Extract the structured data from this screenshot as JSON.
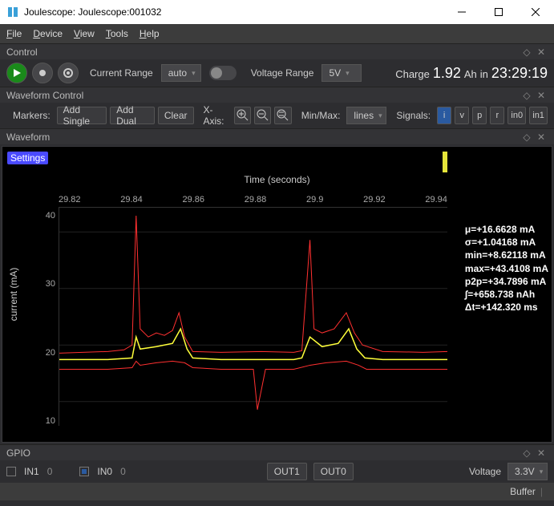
{
  "window": {
    "title": "Joulescope: Joulescope:001032"
  },
  "menu": {
    "file": "File",
    "device": "Device",
    "view": "View",
    "tools": "Tools",
    "help": "Help"
  },
  "panels": {
    "control": "Control",
    "wfctrl": "Waveform Control",
    "wf": "Waveform",
    "gpio": "GPIO"
  },
  "control": {
    "current_range_label": "Current Range",
    "current_range_value": "auto",
    "voltage_range_label": "Voltage Range",
    "voltage_range_value": "5V",
    "charge_label": "Charge",
    "charge_value": "1.92",
    "charge_unit": "Ah",
    "charge_in": "in",
    "charge_time": "23:29:19"
  },
  "wfctrl": {
    "markers_label": "Markers:",
    "add_single": "Add Single",
    "add_dual": "Add Dual",
    "clear": "Clear",
    "xaxis_label": "X-Axis:",
    "minmax_label": "Min/Max:",
    "minmax_value": "lines",
    "signals_label": "Signals:",
    "sig": {
      "i": "i",
      "v": "v",
      "p": "p",
      "r": "r",
      "in0": "in0",
      "in1": "in1"
    }
  },
  "chart_data": {
    "type": "line",
    "title": "Time (seconds)",
    "ylabel": "current (mA)",
    "xticks": [
      "29.82",
      "29.84",
      "29.86",
      "29.88",
      "29.9",
      "29.92",
      "29.94"
    ],
    "yticks": [
      "40",
      "30",
      "20",
      "10"
    ],
    "xlim": [
      29.81,
      29.955
    ],
    "ylim": [
      8,
      45
    ],
    "series": [
      {
        "name": "mean",
        "color": "#ffff3a"
      },
      {
        "name": "min",
        "color": "#ff3030"
      },
      {
        "name": "max",
        "color": "#ff3030"
      }
    ],
    "settings_btn": "Settings",
    "stats": {
      "mu": "μ=+16.6628 mA",
      "sigma": "σ=+1.04168 mA",
      "min": "min=+8.62118 mA",
      "max": "max=+43.4108 mA",
      "p2p": "p2p=+34.7896 mA",
      "int": "∫=+658.738 nAh",
      "dt": "Δt=+142.320 ms"
    }
  },
  "gpio": {
    "in1_label": "IN1",
    "in1_val": "0",
    "in0_label": "IN0",
    "in0_val": "0",
    "out1": "OUT1",
    "out0": "OUT0",
    "voltage_label": "Voltage",
    "voltage_value": "3.3V"
  },
  "status": {
    "buffer": "Buffer"
  }
}
